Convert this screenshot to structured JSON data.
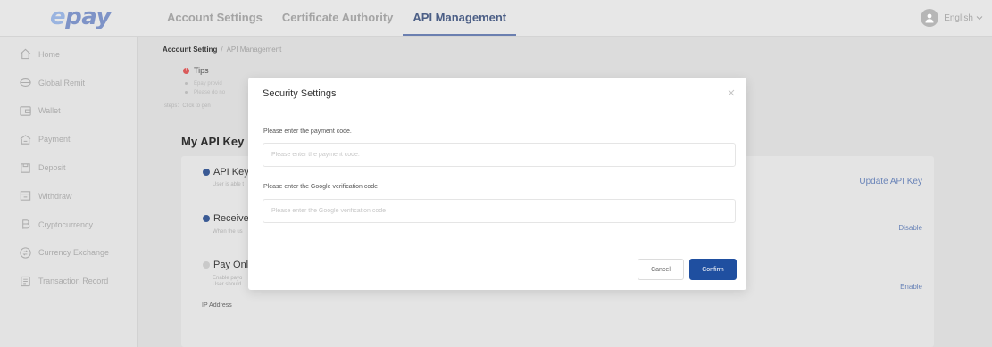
{
  "brand": {
    "logo_e": "e",
    "logo_rest": "pay"
  },
  "nav": {
    "tabs": [
      {
        "label": "Account Settings",
        "active": false
      },
      {
        "label": "Certificate Authority",
        "active": false
      },
      {
        "label": "API Management",
        "active": true
      }
    ]
  },
  "user": {
    "language": "English"
  },
  "sidebar": {
    "items": [
      {
        "label": "Home",
        "icon": "home-icon"
      },
      {
        "label": "Global Remit",
        "icon": "globe-icon"
      },
      {
        "label": "Wallet",
        "icon": "wallet-icon"
      },
      {
        "label": "Payment",
        "icon": "payment-icon"
      },
      {
        "label": "Deposit",
        "icon": "deposit-icon"
      },
      {
        "label": "Withdraw",
        "icon": "withdraw-icon"
      },
      {
        "label": "Cryptocurrency",
        "icon": "crypto-icon"
      },
      {
        "label": "Currency Exchange",
        "icon": "exchange-icon"
      },
      {
        "label": "Transaction Record",
        "icon": "record-icon"
      }
    ]
  },
  "breadcrumb": {
    "level1": "Account Setting",
    "sep": "/",
    "level2": "API Management"
  },
  "tips": {
    "title": "Tips",
    "line1": "Epay provid",
    "line2": "Please do no",
    "steps": "steps：Click to gen"
  },
  "api": {
    "title": "My API Key",
    "rows": [
      {
        "title": "API Key",
        "desc": "User is able t",
        "action": "Update API Key",
        "enabled": true
      },
      {
        "title": "Receive M",
        "desc": "When the us",
        "action": "Disable",
        "enabled": true
      },
      {
        "title": "Pay Online",
        "desc1": "Enable payo",
        "desc2": "User should",
        "action": "Enable",
        "enabled": false
      }
    ],
    "ip_label": "IP Address"
  },
  "modal": {
    "title": "Security Settings",
    "payment_label": "Please enter the payment code.",
    "payment_placeholder": "Please enter the payment code.",
    "google_label": "Please enter the Google verification code",
    "google_placeholder": "Please enter the Google verification code",
    "cancel": "Cancel",
    "confirm": "Confirm"
  },
  "colors": {
    "primary": "#1f4fa0",
    "link": "#6a84b8",
    "tips_dot": "#d95a5a"
  }
}
